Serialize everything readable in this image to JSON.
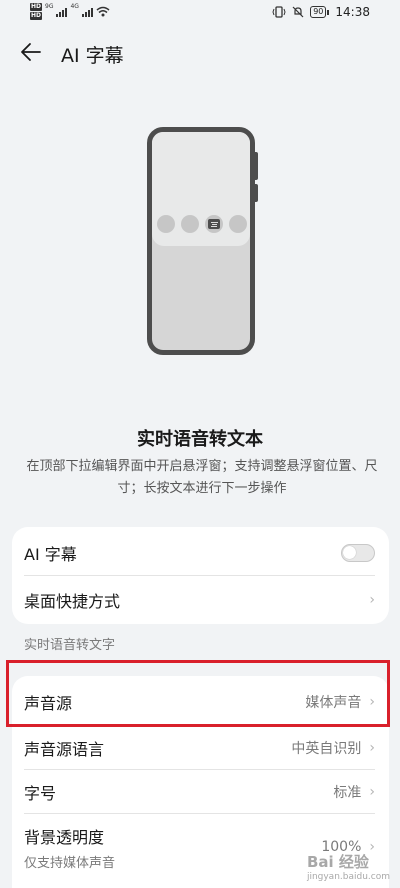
{
  "status_bar": {
    "hd1": "HD",
    "hd2": "HD",
    "net_small": "9G",
    "net_4g": "4G",
    "battery": "90",
    "time": "14:38"
  },
  "app_bar": {
    "title": "AI 字幕"
  },
  "feature": {
    "title": "实时语音转文本",
    "description": "在顶部下拉编辑界面中开启悬浮窗；支持调整悬浮窗位置、尺寸；长按文本进行下一步操作"
  },
  "settings_card": {
    "ai_caption_label": "AI 字幕",
    "ai_caption_enabled": false,
    "shortcut_label": "桌面快捷方式"
  },
  "section_header": "实时语音转文字",
  "realtime_card": {
    "rows": [
      {
        "label": "声音源",
        "value": "媒体声音"
      },
      {
        "label": "声音源语言",
        "value": "中英自识别"
      },
      {
        "label": "字号",
        "value": "标准"
      },
      {
        "label": "背景透明度",
        "value": "100%",
        "sub": "仅支持媒体声音"
      }
    ]
  },
  "watermark": {
    "text": "Bai 经验",
    "url": "jingyan.baidu.com"
  },
  "colors": {
    "background": "#f1f3f5",
    "card": "#ffffff",
    "highlight": "#d9202b"
  }
}
